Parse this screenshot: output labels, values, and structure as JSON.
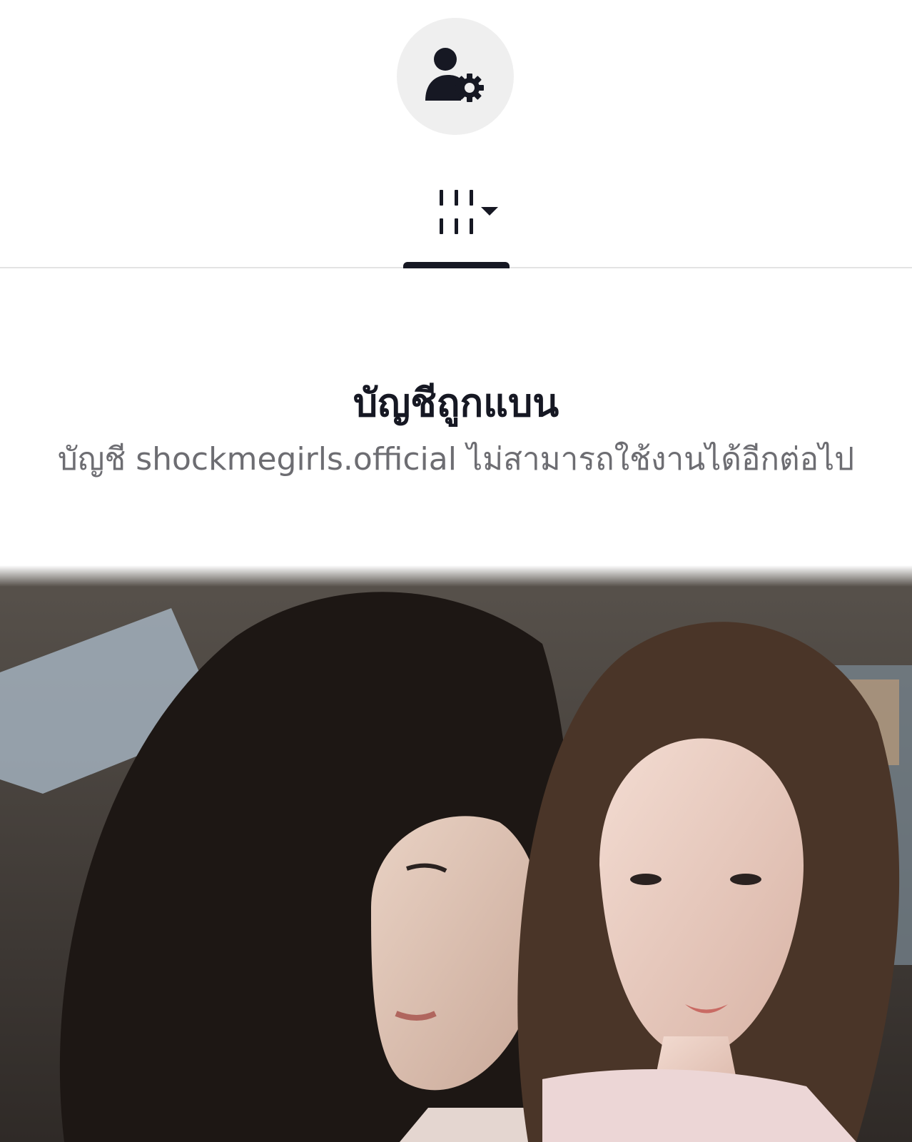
{
  "profile": {
    "avatar_icon": "user-gear-icon"
  },
  "tabs": {
    "grid_icon": "grid-dropdown-icon",
    "active_tab": "grid"
  },
  "banned": {
    "title": "บัญชีถูกแบน",
    "message": "บัญชี shockmegirls.official ไม่สามารถใช้งานได้อีกต่อไป"
  },
  "photo": {
    "description_icon": "photo-image"
  },
  "colors": {
    "text_primary": "#161823",
    "text_secondary": "#6d6d72",
    "avatar_bg": "#efefef",
    "divider": "#e3e3e3"
  }
}
